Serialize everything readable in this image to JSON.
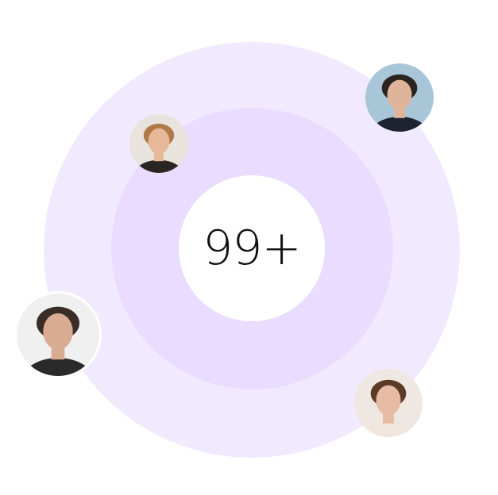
{
  "badge": {
    "count_label": "99+"
  },
  "colors": {
    "outer_ring": "#f1eafe",
    "inner_ring": "#e9dcfe",
    "center": "#ffffff"
  },
  "avatars": [
    {
      "name": "avatar-man-dark-hair",
      "bg": "#a9c6d8",
      "skin": "#e0b49a",
      "hair": "#2a2320",
      "cloth": "#1d2430"
    },
    {
      "name": "avatar-woman-blonde",
      "bg": "#e9e3de",
      "skin": "#e7b89a",
      "hair": "#b07a48",
      "cloth": "#2b2522"
    },
    {
      "name": "avatar-man-glitch",
      "bg": "#f0f0f0",
      "skin": "#d9ab92",
      "hair": "#3a2d28",
      "cloth": "#2a2a2a"
    },
    {
      "name": "avatar-woman-brunette",
      "bg": "#efe7e2",
      "skin": "#e7bba4",
      "hair": "#5a3b28",
      "cloth": "#f1e6dd"
    }
  ]
}
